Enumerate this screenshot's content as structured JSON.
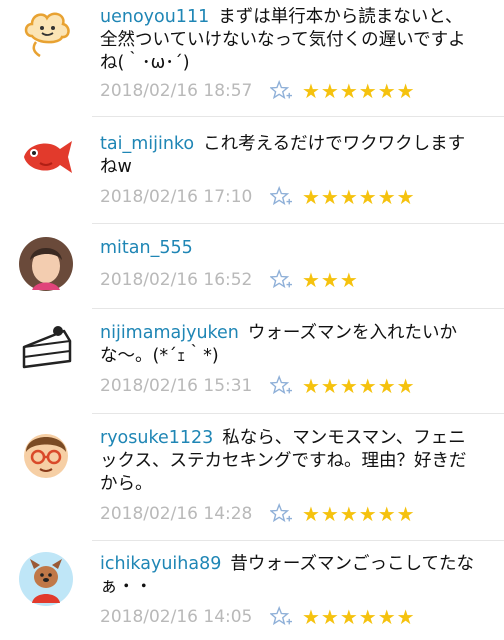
{
  "comments": [
    {
      "username": "uenoyou111",
      "text": "まずは単行本から読まないと、全然ついていけないなって気付くの遅いですよね(｀･ω･´)",
      "date": "2018/02/16 18:57",
      "stars": "★★★★★★",
      "rating": 6,
      "avatar_icon": "cloud-face-icon"
    },
    {
      "username": "tai_mijinko",
      "text": "これ考えるだけでワクワクしますねw",
      "date": "2018/02/16 17:10",
      "stars": "★★★★★★",
      "rating": 6,
      "avatar_icon": "red-fish-icon"
    },
    {
      "username": "mitan_555",
      "text": "",
      "date": "2018/02/16 16:52",
      "stars": "★★★",
      "rating": 3,
      "avatar_icon": "woman-photo-icon"
    },
    {
      "username": "nijimamajyuken",
      "text": "ウォーズマンを入れたいかな〜。(*´ｪ｀*)",
      "date": "2018/02/16 15:31",
      "stars": "★★★★★★",
      "rating": 6,
      "avatar_icon": "cake-slice-icon"
    },
    {
      "username": "ryosuke1123",
      "text": "私なら、マンモスマン、フェニックス、ステカセキングですね。理由？好きだから。",
      "date": "2018/02/16 14:28",
      "stars": "★★★★★★",
      "rating": 6,
      "avatar_icon": "boy-glasses-icon"
    },
    {
      "username": "ichikayuiha89",
      "text": "昔ウォーズマンごっこしてたなぁ・・",
      "date": "2018/02/16 14:05",
      "stars": "★★★★★★",
      "rating": 6,
      "avatar_icon": "dog-character-icon"
    }
  ],
  "colors": {
    "username": "#1f86b5",
    "date": "#b9b9b9",
    "star": "#f5c20e",
    "favorite_icon": "#8fb0d8"
  },
  "favorite_icon": "star-plus-icon"
}
